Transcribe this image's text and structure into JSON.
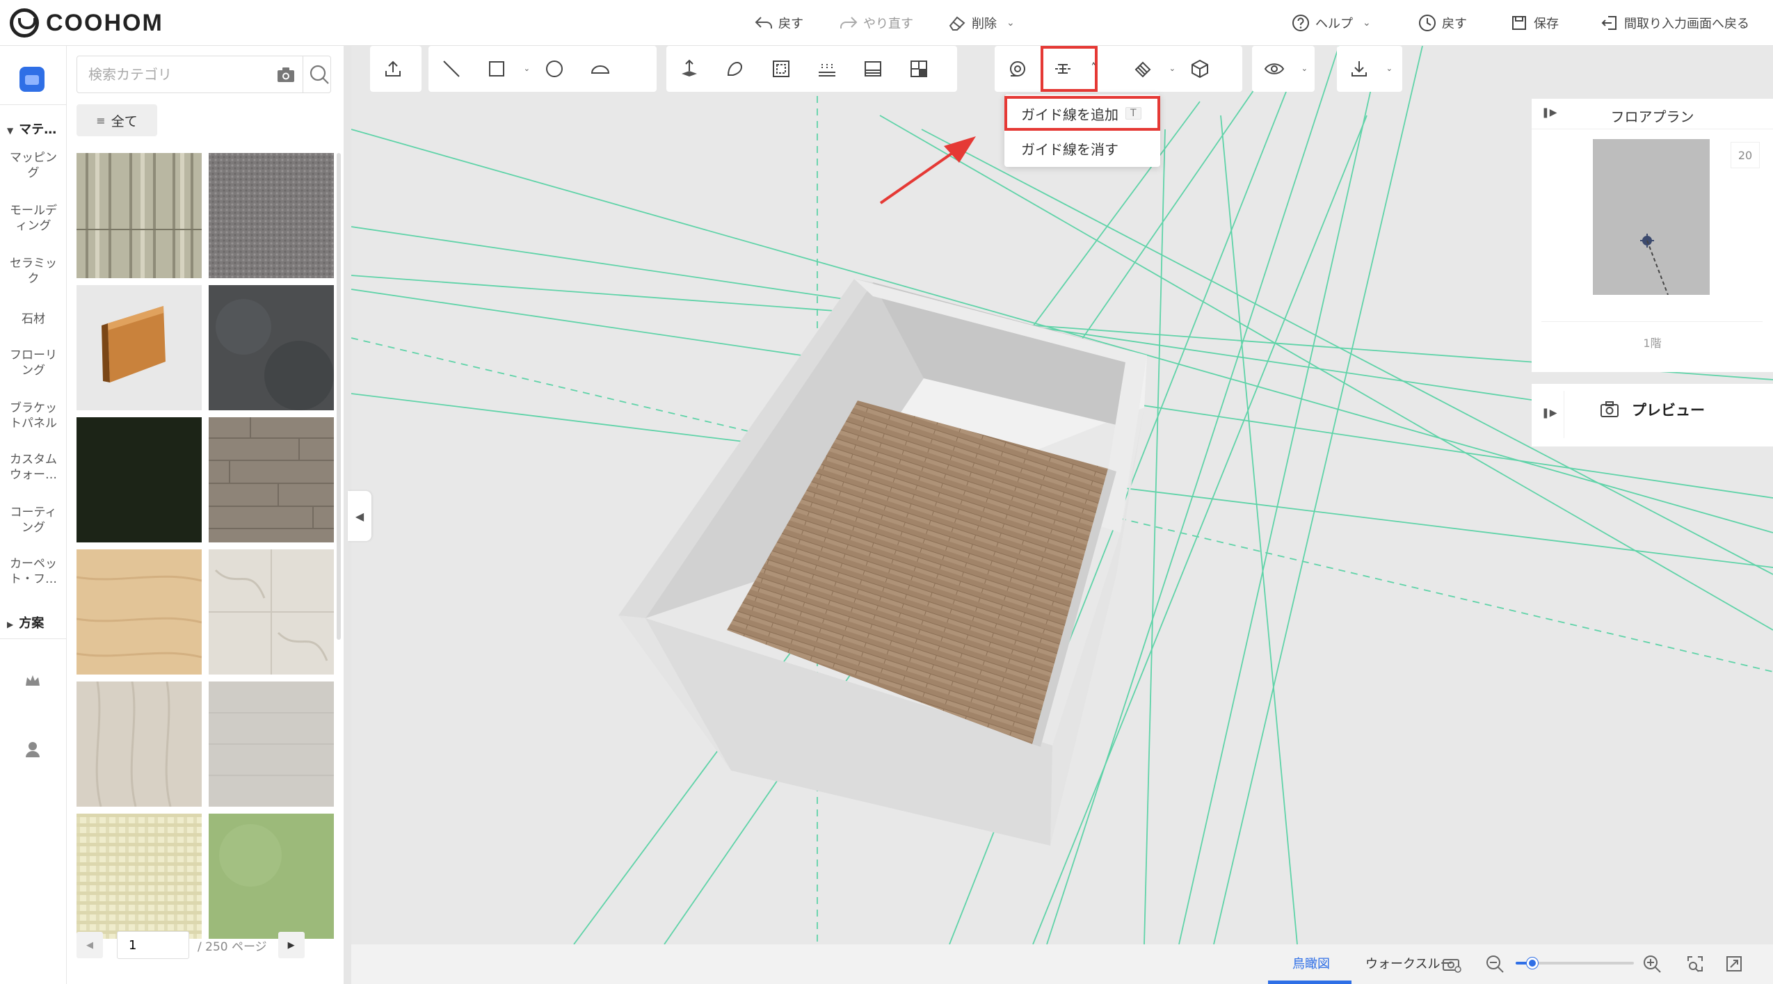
{
  "app": {
    "logo_text": "COOHOM"
  },
  "header": {
    "undo": "戻す",
    "redo": "やり直す",
    "delete": "削除",
    "help": "ヘルプ",
    "history": "戻す",
    "save": "保存",
    "back_to_floorplan": "間取り入力画面へ戻る"
  },
  "rail": {
    "group_material": "マテ…",
    "items": [
      "マッピング",
      "モールディング",
      "セラミック",
      "石材",
      "フローリング",
      "ブラケットパネル",
      "カスタムウォー…",
      "コーティング",
      "カーペット・フ…"
    ],
    "group_plan": "方案"
  },
  "panel": {
    "search_placeholder": "検索カテゴリ",
    "all_label": "全て",
    "page_value": "1",
    "page_total": "/ 250 ページ"
  },
  "swatches": [
    {
      "name": "weathered-wood-texture"
    },
    {
      "name": "grey-carpet-texture"
    },
    {
      "name": "wood-baseboard-molding"
    },
    {
      "name": "dark-stone-texture"
    },
    {
      "name": "dark-green-solid"
    },
    {
      "name": "grey-wood-plank-texture"
    },
    {
      "name": "light-oak-texture"
    },
    {
      "name": "white-marble-texture"
    },
    {
      "name": "pale-wood-texture"
    },
    {
      "name": "light-grey-fabric-texture"
    },
    {
      "name": "beige-check-fabric"
    },
    {
      "name": "green-plaster-texture"
    }
  ],
  "colors": {
    "accent": "#2f6fe6",
    "highlight": "#e53935",
    "guide_line": "#5fd3a8"
  },
  "dropdown": {
    "add_guide": "ガイド線を追加",
    "add_guide_shortcut": "T",
    "remove_guide": "ガイド線を消す"
  },
  "right": {
    "floorplan_title": "フロアプラン",
    "zoom_value": "20",
    "floor_label": "1階",
    "preview_label": "プレビュー"
  },
  "bottom": {
    "view_birdseye": "鳥瞰図",
    "view_walkthrough": "ウォークスルー",
    "zoom_level": 0.14
  }
}
